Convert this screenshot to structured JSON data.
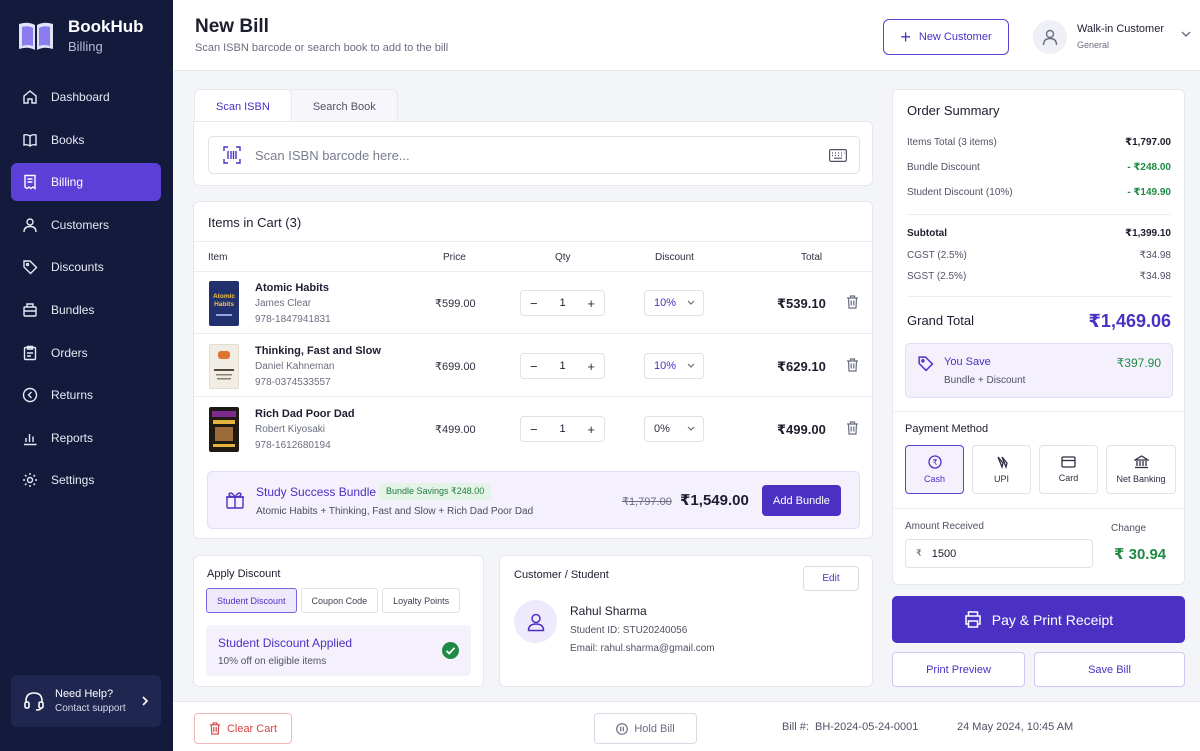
{
  "brand": {
    "name": "BookHub",
    "sub": "Billing"
  },
  "sidebar": {
    "items": [
      {
        "label": "Dashboard",
        "icon": "home-icon"
      },
      {
        "label": "Books",
        "icon": "book-icon"
      },
      {
        "label": "Billing",
        "icon": "receipt-icon",
        "active": true
      },
      {
        "label": "Customers",
        "icon": "user-icon"
      },
      {
        "label": "Discounts",
        "icon": "tag-icon"
      },
      {
        "label": "Bundles",
        "icon": "package-icon"
      },
      {
        "label": "Orders",
        "icon": "clipboard-icon"
      },
      {
        "label": "Returns",
        "icon": "return-icon"
      },
      {
        "label": "Reports",
        "icon": "bar-chart-icon"
      },
      {
        "label": "Settings",
        "icon": "gear-icon"
      }
    ]
  },
  "help": {
    "title": "Need Help?",
    "sub": "Contact support"
  },
  "header": {
    "title": "New Bill",
    "subtitle": "Scan ISBN barcode or search book to add to the bill",
    "new_customer": "New Customer",
    "customer": {
      "name": "Walk-in Customer",
      "type": "General"
    }
  },
  "tabs": {
    "scan": "Scan ISBN",
    "search": "Search Book"
  },
  "scan": {
    "placeholder": "Scan ISBN barcode here..."
  },
  "cart": {
    "title": "Items in Cart (3)",
    "columns": {
      "item": "Item",
      "price": "Price",
      "qty": "Qty",
      "discount": "Discount",
      "total": "Total"
    },
    "rows": [
      {
        "title": "Atomic Habits",
        "author": "James Clear",
        "isbn": "978-1847941831",
        "price": "₹599.00",
        "qty": "1",
        "discount": "10%",
        "total": "₹539.10"
      },
      {
        "title": "Thinking, Fast and Slow",
        "author": "Daniel Kahneman",
        "isbn": "978-0374533557",
        "price": "₹699.00",
        "qty": "1",
        "discount": "10%",
        "total": "₹629.10"
      },
      {
        "title": "Rich Dad Poor Dad",
        "author": "Robert Kiyosaki",
        "isbn": "978-1612680194",
        "price": "₹499.00",
        "qty": "1",
        "discount": "0%",
        "total": "₹499.00"
      }
    ],
    "qty_minus": "−",
    "qty_plus": "+"
  },
  "book_covers": [
    {
      "text": "Atomic Habits",
      "color": "#22306e"
    },
    {
      "text": "",
      "color": "#f1ede4"
    },
    {
      "text": "",
      "color": "#1f1a14"
    }
  ],
  "bundle": {
    "title": "Study Success Bundle",
    "badge": "Bundle Savings ₹248.00",
    "desc": "Atomic Habits + Thinking, Fast and Slow + Rich Dad Poor Dad",
    "old_price": "₹1,797.00",
    "new_price": "₹1,549.00",
    "button": "Add Bundle"
  },
  "discount": {
    "title": "Apply Discount",
    "tabs": [
      "Student Discount",
      "Coupon Code",
      "Loyalty Points"
    ],
    "applied_title": "Student Discount Applied",
    "applied_sub": "10% off on eligible items"
  },
  "student": {
    "title": "Customer / Student",
    "edit": "Edit",
    "name": "Rahul Sharma",
    "id": "Student ID: STU20240056",
    "email": "Email: rahul.sharma@gmail.com"
  },
  "summary": {
    "title": "Order Summary",
    "items_total_label": "Items Total (3 items)",
    "items_total": "₹1,797.00",
    "bundle_discount_label": "Bundle Discount",
    "bundle_discount": "- ₹248.00",
    "student_discount_label": "Student Discount (10%)",
    "student_discount": "- ₹149.90",
    "subtotal_label": "Subtotal",
    "subtotal": "₹1,399.10",
    "cgst_label": "CGST (2.5%)",
    "cgst": "₹34.98",
    "sgst_label": "SGST (2.5%)",
    "sgst": "₹34.98",
    "grand_label": "Grand Total",
    "grand": "₹1,469.06",
    "save_title": "You Save",
    "save_sub": "Bundle + Discount",
    "save_value": "₹397.90",
    "payment_title": "Payment Method",
    "payment_methods": [
      "Cash",
      "UPI",
      "Card",
      "Net Banking"
    ],
    "amount_label": "Amount Received",
    "amount_currency": "₹",
    "amount_value": "1500",
    "change_label": "Change",
    "change_value": "₹ 30.94"
  },
  "actions": {
    "pay": "Pay & Print Receipt",
    "preview": "Print Preview",
    "save": "Save Bill"
  },
  "footer": {
    "clear": "Clear Cart",
    "hold": "Hold Bill",
    "bill_no": "Bill #:  BH-2024-05-24-0001",
    "date": "24 May 2024, 10:45 AM"
  },
  "colors": {
    "accent": "#4b30c4",
    "sidebar": "#141a3c",
    "success": "#1f8a44",
    "danger": "#d64545"
  }
}
